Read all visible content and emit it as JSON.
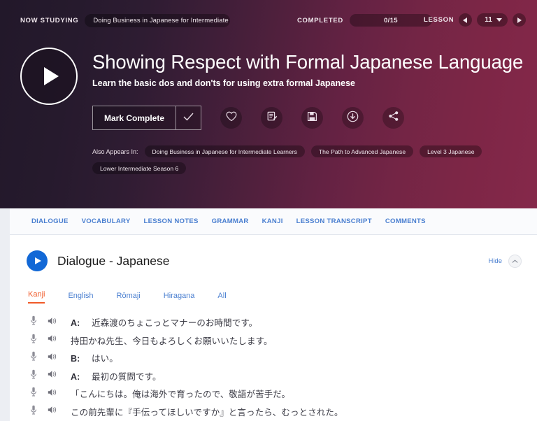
{
  "topbar": {
    "now_studying_label": "NOW STUDYING",
    "course_name": "Doing Business in Japanese for Intermediate L...",
    "completed_label": "COMPLETED",
    "completed_value": "0/15",
    "lesson_label": "LESSON",
    "lesson_number": "11",
    "prev_icon": "caret-left-icon",
    "next_icon": "caret-right-icon",
    "dropdown_icon": "caret-down-icon"
  },
  "hero": {
    "play_icon": "play-icon",
    "title": "Showing Respect with Formal Japanese Language",
    "subtitle": "Learn the basic dos and don'ts for using extra formal Japanese",
    "mark_complete_label": "Mark Complete",
    "check_icon": "check-icon",
    "actions": [
      {
        "name": "favorite-button",
        "icon": "heart-icon"
      },
      {
        "name": "notes-button",
        "icon": "notepad-pen-icon"
      },
      {
        "name": "save-button",
        "icon": "floppy-disk-icon"
      },
      {
        "name": "download-button",
        "icon": "download-circle-icon"
      },
      {
        "name": "share-button",
        "icon": "share-icon"
      }
    ],
    "also_appears_label": "Also Appears In:",
    "also_appears": [
      "Doing Business in Japanese for Intermediate Learners",
      "The Path to Advanced Japanese",
      "Level 3 Japanese",
      "Lower Intermediate Season 6"
    ],
    "gradient_start": "#22182a",
    "gradient_end": "#85284a"
  },
  "nav": {
    "tabs": [
      "DIALOGUE",
      "VOCABULARY",
      "LESSON NOTES",
      "GRAMMAR",
      "KANJI",
      "LESSON TRANSCRIPT",
      "COMMENTS"
    ],
    "link_color": "#4a7fd0"
  },
  "dialogue": {
    "play_icon": "play-icon",
    "title": "Dialogue - Japanese",
    "hide_label": "Hide",
    "collapse_icon": "chevron-up-icon",
    "script_tabs": [
      {
        "label": "Kanji",
        "active": true
      },
      {
        "label": "English",
        "active": false
      },
      {
        "label": "Rōmaji",
        "active": false
      },
      {
        "label": "Hiragana",
        "active": false
      },
      {
        "label": "All",
        "active": false
      }
    ],
    "active_tab_color": "#f05a28",
    "mic_icon": "microphone-icon",
    "speaker_icon": "speaker-icon",
    "lines": [
      {
        "speaker": "A:",
        "text": "近森渡のちょこっとマナーのお時間です。"
      },
      {
        "speaker": "",
        "text": "持田かね先生、今日もよろしくお願いいたします。"
      },
      {
        "speaker": "B:",
        "text": "はい。"
      },
      {
        "speaker": "A:",
        "text": "最初の質問です。"
      },
      {
        "speaker": "",
        "text": "「こんにちは。俺は海外で育ったので、敬語が苦手だ。"
      },
      {
        "speaker": "",
        "text": "この前先輩に『手伝ってほしいですか』と言ったら、むっとされた。"
      }
    ]
  }
}
